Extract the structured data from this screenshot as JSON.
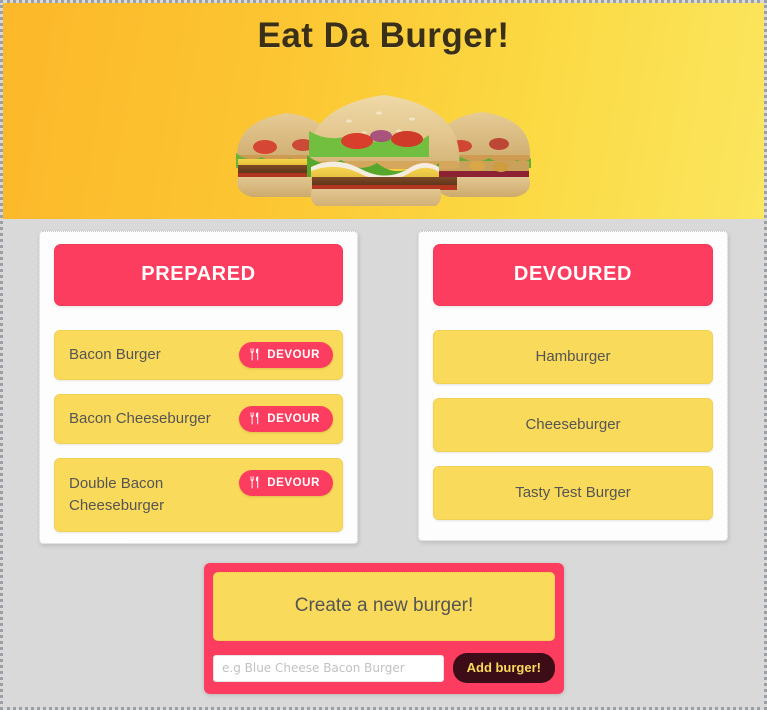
{
  "hero": {
    "title": "Eat Da Burger!",
    "image_name": "triple-burger-photo",
    "gradient_from": "#fcb82a",
    "gradient_to": "#fbe65f",
    "title_color": "#3a3017"
  },
  "colors": {
    "accent_pink": "#fd3d5f",
    "accent_yellow": "#fada5a",
    "page_background": "#d9d9d9",
    "card_background": "#fdfdfd",
    "add_button_background": "#3d0d17",
    "add_button_text": "#fada5a",
    "list_text": "#555555"
  },
  "columns": [
    {
      "id": "prepared",
      "header": "PREPARED",
      "items": [
        {
          "name": "Bacon Burger",
          "action_label": "DEVOUR",
          "action_icon": "utensils-icon",
          "two_line": false
        },
        {
          "name": "Bacon Cheeseburger",
          "action_label": "DEVOUR",
          "action_icon": "utensils-icon",
          "two_line": false
        },
        {
          "name": "Double Bacon Cheeseburger",
          "action_label": "DEVOUR",
          "action_icon": "utensils-icon",
          "two_line": true
        }
      ]
    },
    {
      "id": "devoured",
      "header": "DEVOURED",
      "items": [
        {
          "name": "Hamburger"
        },
        {
          "name": "Cheeseburger"
        },
        {
          "name": "Tasty Test Burger"
        }
      ]
    }
  ],
  "create_form": {
    "title": "Create a new burger!",
    "input_placeholder": "e.g Blue Cheese Bacon Burger",
    "input_value": "",
    "submit_label": "Add burger!"
  }
}
